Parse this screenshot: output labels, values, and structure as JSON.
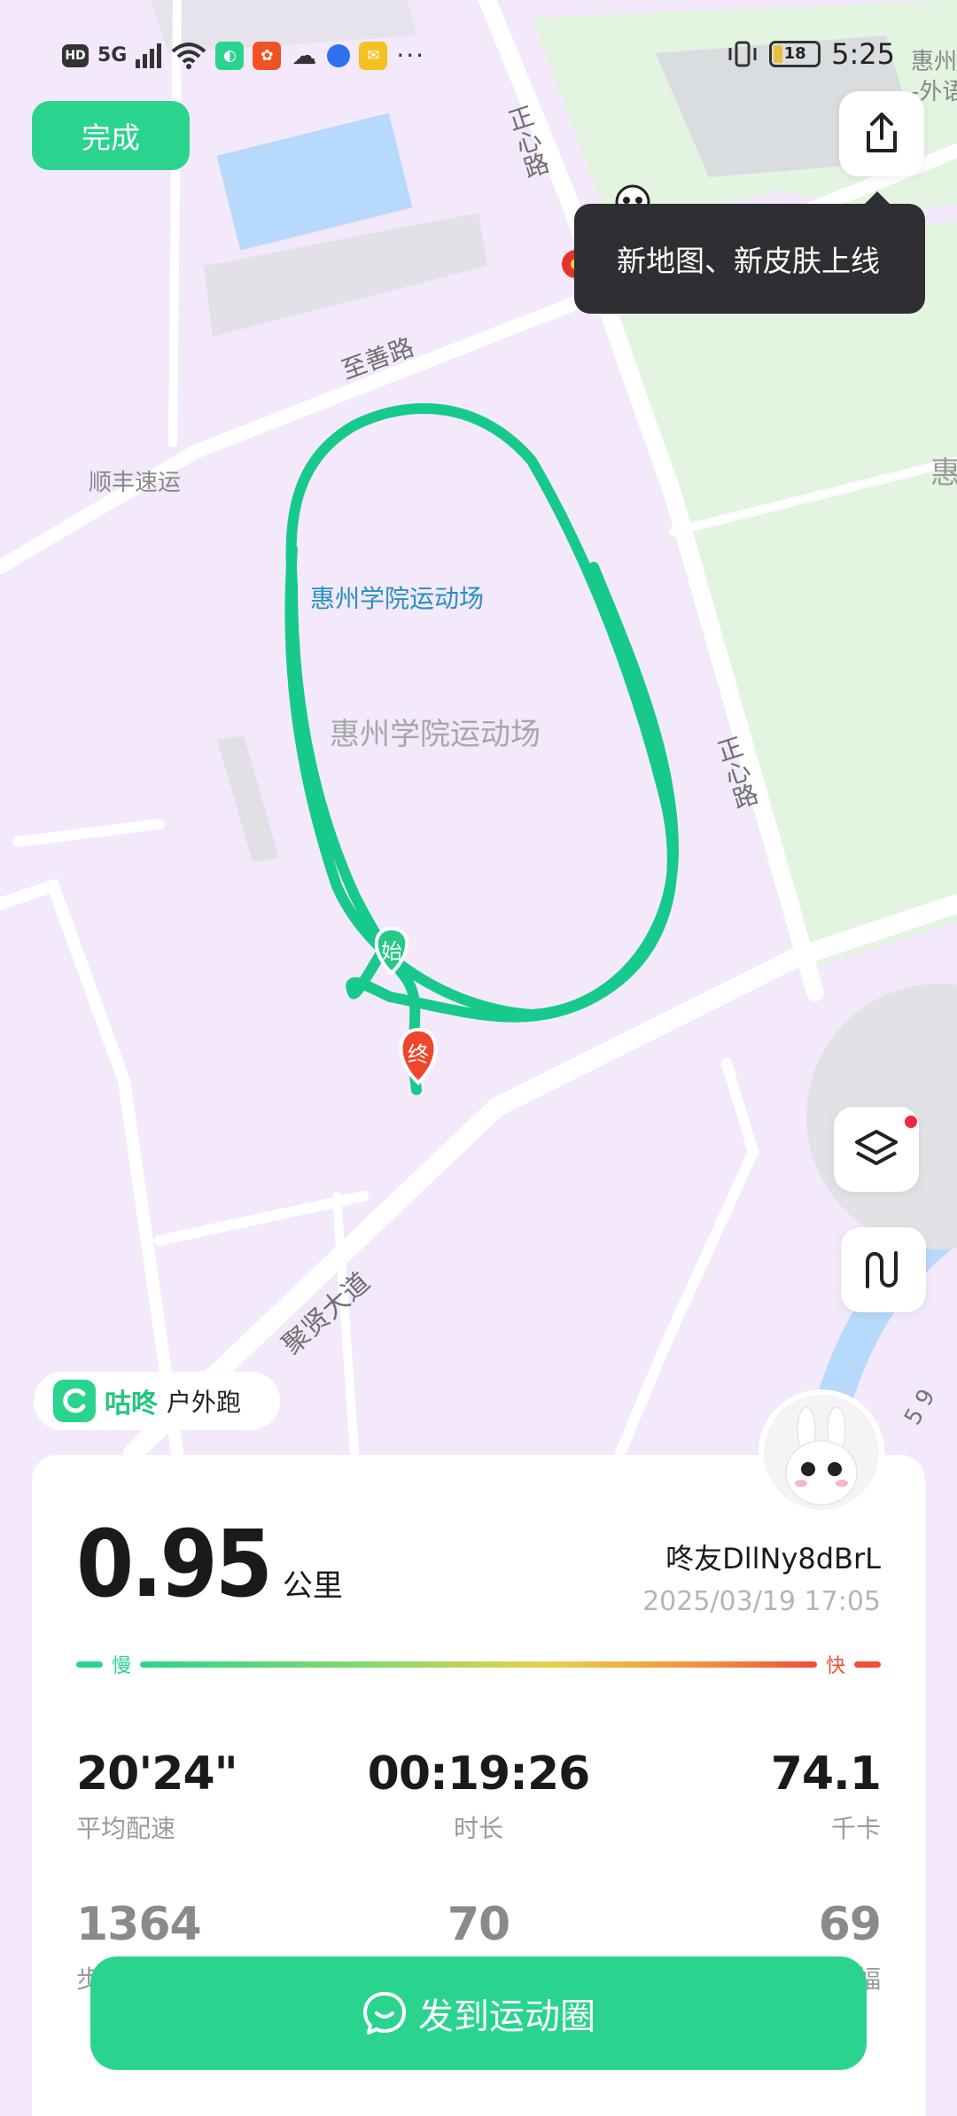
{
  "status_bar": {
    "hd": "HD",
    "net": "5G",
    "battery_level": "18",
    "time": "5:25",
    "more": "···"
  },
  "top": {
    "done_label": "完成",
    "banner_text": "新地图、新皮肤上线"
  },
  "map": {
    "labels": {
      "road_zhengxin_1": "正心路",
      "road_zhengxin_2": "正心路",
      "road_zhishan": "至善路",
      "road_juxian": "聚贤大道",
      "poi_shunfeng": "顺丰速运",
      "poi_stadium_blue": "惠州学院运动场",
      "poi_stadium_gray": "惠州学院运动场",
      "edge_top_right": "惠州",
      "edge_top_right_2": "-外语",
      "edge_right": "惠",
      "edge_right_num": "5 9"
    },
    "start_marker": "始",
    "end_marker": "终",
    "route_color": "#17c98a"
  },
  "brand": {
    "name": "咕咚",
    "activity_type": "户外跑"
  },
  "summary": {
    "distance_value": "0.95",
    "distance_unit": "公里",
    "user_name": "咚友DllNy8dBrL",
    "date_time": "2025/03/19 17:05",
    "pace_slow": "慢",
    "pace_fast": "快",
    "stats": [
      {
        "value": "20'24\"",
        "label": "平均配速"
      },
      {
        "value": "00:19:26",
        "label": "时长"
      },
      {
        "value": "74.1",
        "label": "千卡"
      }
    ],
    "stats_row2": [
      {
        "value": "1364",
        "label": "步"
      },
      {
        "value": "70",
        "label": ""
      },
      {
        "value": "69",
        "label": "幅"
      }
    ]
  },
  "post_button_label": "发到运动圈",
  "colors": {
    "accent": "#2bd48e",
    "map_bg": "#f3e9fb",
    "green_area": "#e3f5e1",
    "water": "#b7d9fb"
  }
}
